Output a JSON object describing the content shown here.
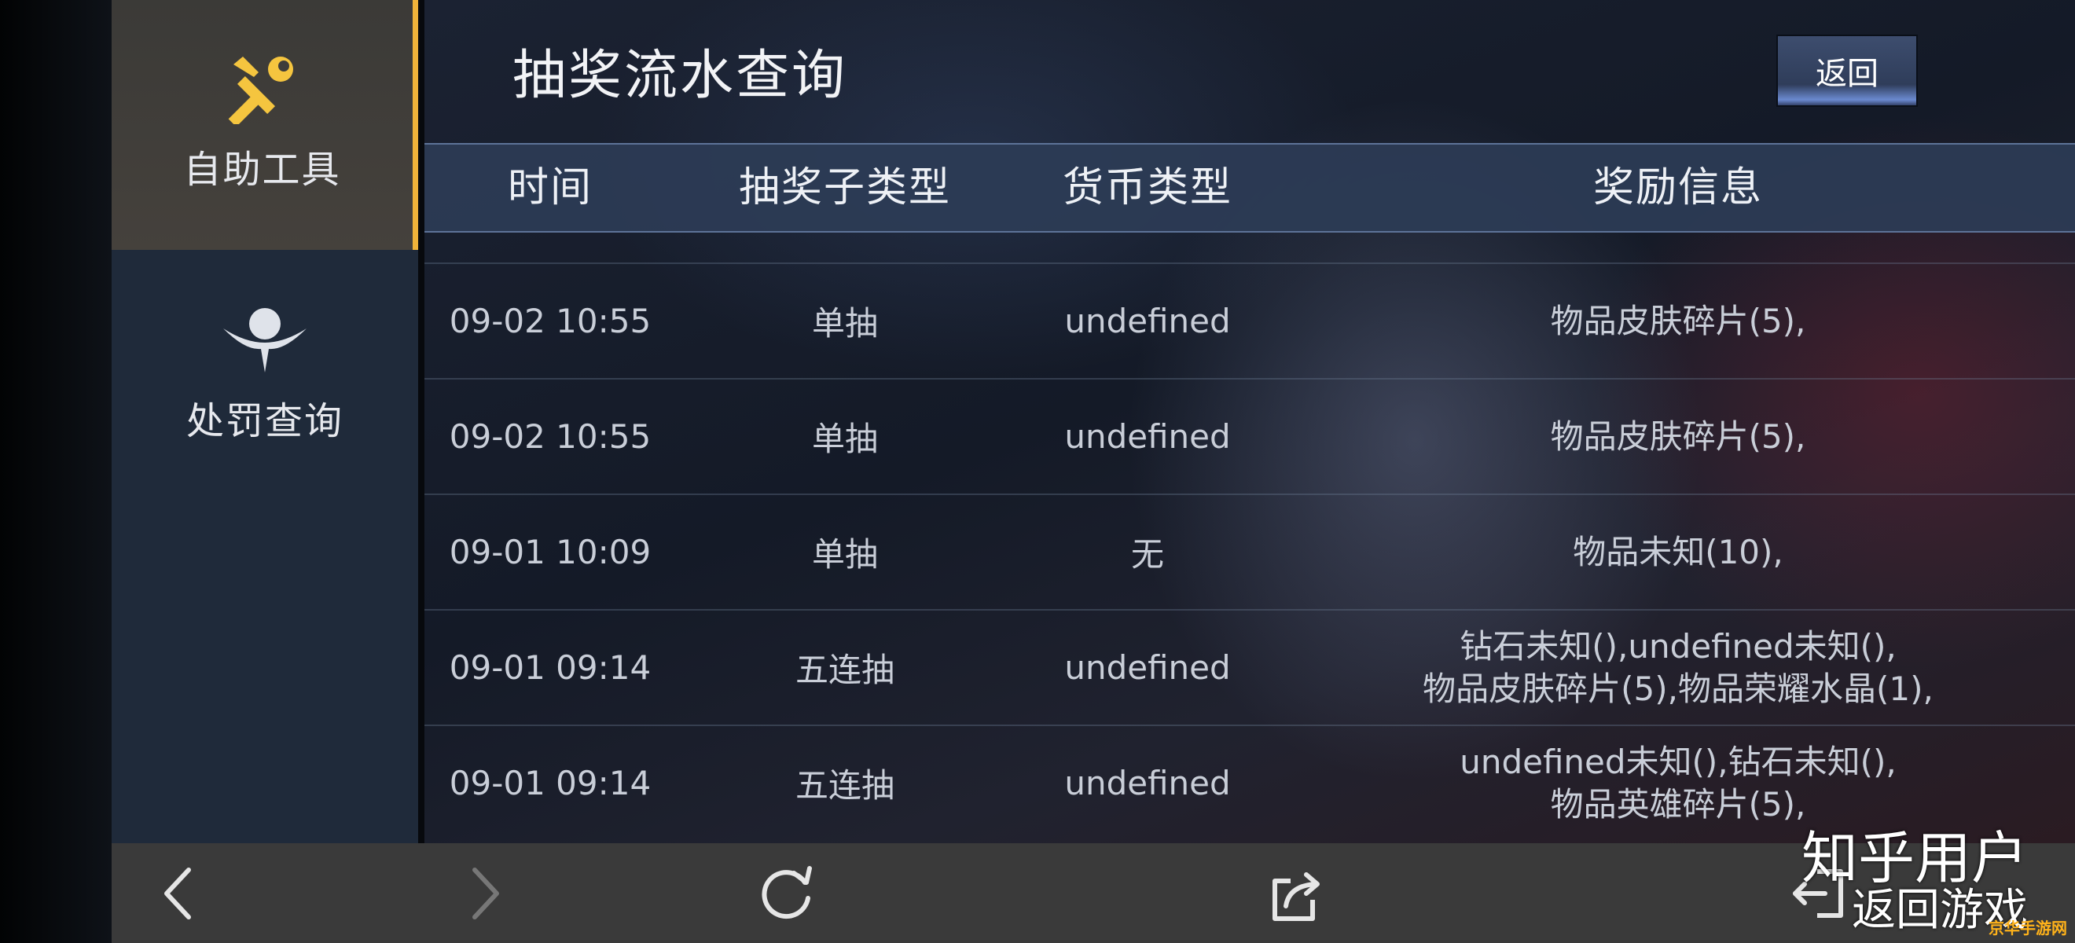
{
  "sidebar": {
    "items": [
      {
        "label": "自助工具",
        "icon": "tools-icon",
        "active": true
      },
      {
        "label": "处罚查询",
        "icon": "emblem-icon",
        "active": false
      }
    ],
    "accent": "#f0b33a"
  },
  "header": {
    "title": "抽奖流水查询",
    "back_label": "返回"
  },
  "table": {
    "columns": [
      "时间",
      "抽奖子类型",
      "货币类型",
      "奖励信息"
    ],
    "rows": [
      {
        "time": "09-02 10:55",
        "subtype": "单抽",
        "currency": "undefined",
        "reward": [
          "物品皮肤碎片(5),"
        ]
      },
      {
        "time": "09-02 10:55",
        "subtype": "单抽",
        "currency": "undefined",
        "reward": [
          "物品皮肤碎片(5),"
        ]
      },
      {
        "time": "09-01 10:09",
        "subtype": "单抽",
        "currency": "无",
        "reward": [
          "物品未知(10),"
        ]
      },
      {
        "time": "09-01 09:14",
        "subtype": "五连抽",
        "currency": "undefined",
        "reward": [
          "钻石未知(),undefined未知(),",
          "物品皮肤碎片(5),物品荣耀水晶(1),"
        ]
      },
      {
        "time": "09-01 09:14",
        "subtype": "五连抽",
        "currency": "undefined",
        "reward": [
          "undefined未知(),钻石未知(),",
          "物品英雄碎片(5),"
        ]
      }
    ]
  },
  "bottom_nav": {
    "icons": [
      "back-arrow-icon",
      "forward-arrow-icon",
      "refresh-icon",
      "share-icon",
      "exit-icon"
    ]
  },
  "watermark": {
    "line1": "知乎用户",
    "line2": "返回游戏",
    "small": "京华手游网"
  }
}
